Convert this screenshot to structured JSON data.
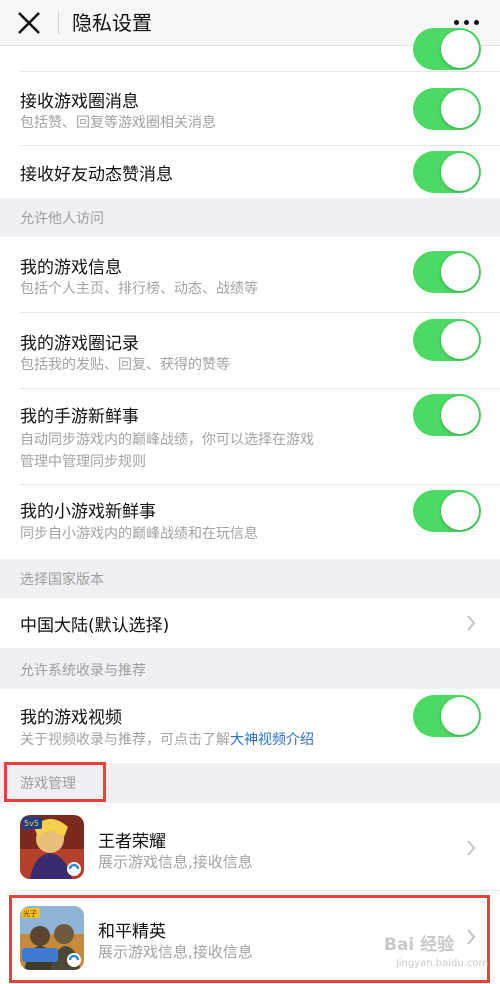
{
  "header": {
    "title": "隐私设置"
  },
  "colors": {
    "toggle_on": "#4cd964",
    "link": "#2a6fcb",
    "highlight_box": "#e8403a"
  },
  "toggles": {
    "top_partial": true,
    "circle_messages": true,
    "friend_like_messages": true,
    "game_info": true,
    "circle_records": true,
    "mobile_news": true,
    "mini_game_news": true,
    "game_video": true
  },
  "rows": {
    "circle_messages": {
      "title": "接收游戏圈消息",
      "desc": "包括赞、回复等游戏圈相关消息"
    },
    "friend_like_messages": {
      "title": "接收好友动态赞消息"
    },
    "game_info": {
      "title": "我的游戏信息",
      "desc": "包括个人主页、排行榜、动态、战绩等"
    },
    "circle_records": {
      "title": "我的游戏圈记录",
      "desc": "包括我的发贴、回复、获得的赞等"
    },
    "mobile_news": {
      "title": "我的手游新鲜事",
      "desc_line1": "自动同步游戏内的巅峰战绩，你可以选择在游戏",
      "desc_line2": "管理中管理同步规则"
    },
    "mini_game_news": {
      "title": "我的小游戏新鲜事",
      "desc": "同步自小游戏内的巅峰战绩和在玩信息"
    },
    "country": {
      "title": "中国大陆(默认选择)"
    },
    "game_video": {
      "title": "我的游戏视频",
      "desc_prefix": "关于视频收录与推荐，可点击了解",
      "desc_link": "大神视频介绍"
    }
  },
  "sections": {
    "allow_visit": "允许他人访问",
    "country_version": "选择国家版本",
    "system_recommend": "允许系统收录与推荐",
    "game_manage": "游戏管理"
  },
  "games": [
    {
      "name": "王者荣耀",
      "desc": "展示游戏信息,接收信息",
      "icon": "honor-of-kings-icon",
      "badge": "5v5"
    },
    {
      "name": "和平精英",
      "desc": "展示游戏信息,接收信息",
      "icon": "game-for-peace-icon",
      "badge": "光子"
    }
  ],
  "watermark": {
    "text": "Bai 经验",
    "url_text": "jingyan.baidu.com"
  }
}
